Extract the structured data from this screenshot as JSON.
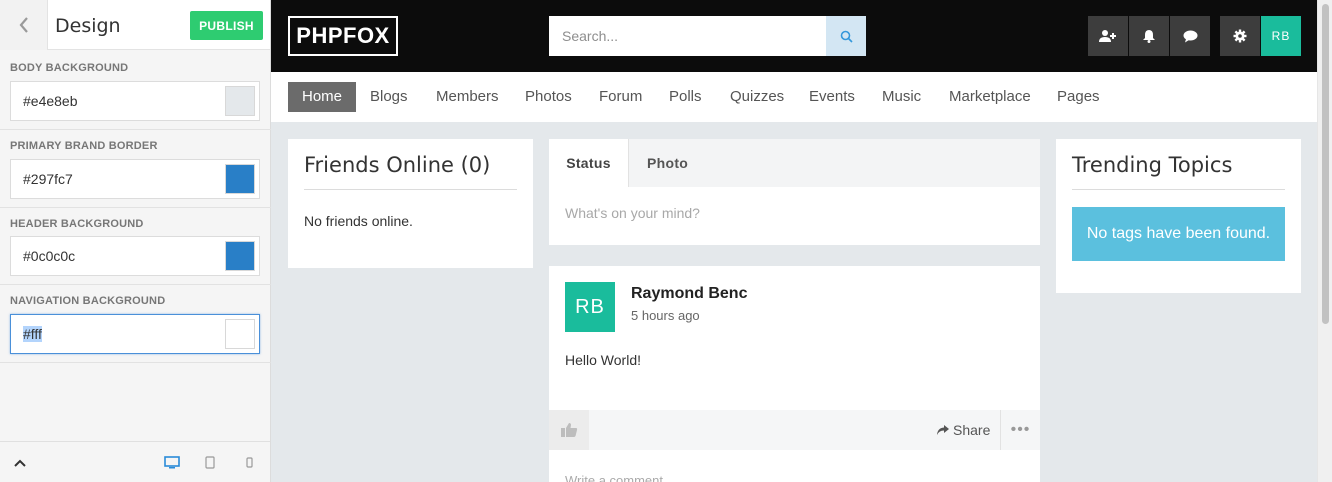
{
  "customizer": {
    "title": "Design",
    "publish_label": "PUBLISH",
    "fields": [
      {
        "label": "BODY BACKGROUND",
        "value": "#e4e8eb",
        "swatch": "#e4e8eb"
      },
      {
        "label": "PRIMARY BRAND BORDER",
        "value": "#297fc7",
        "swatch": "#297fc7"
      },
      {
        "label": "HEADER BACKGROUND",
        "value": "#0c0c0c",
        "swatch": "#297fc7"
      },
      {
        "label": "NAVIGATION BACKGROUND",
        "value": "#fff",
        "swatch": "#ffffff"
      }
    ],
    "footer_icons": [
      "collapse-up-icon",
      "desktop-preview-icon",
      "tablet-preview-icon",
      "mobile-preview-icon"
    ]
  },
  "header": {
    "logo": "PHPFOX",
    "search_placeholder": "Search...",
    "avatar_initials": "RB",
    "icons": [
      "add-friend-icon",
      "bell-icon",
      "chat-icon",
      "gear-icon"
    ]
  },
  "nav": {
    "items": [
      "Home",
      "Blogs",
      "Members",
      "Photos",
      "Forum",
      "Polls",
      "Quizzes",
      "Events",
      "Music",
      "Marketplace",
      "Pages"
    ],
    "active": "Home"
  },
  "friends": {
    "title": "Friends Online (0)",
    "empty": "No friends online."
  },
  "composer": {
    "tabs": [
      "Status",
      "Photo"
    ],
    "placeholder": "What's on your mind?"
  },
  "feed": {
    "avatar_initials": "RB",
    "author": "Raymond Benc",
    "time": "5 hours ago",
    "text": "Hello World!",
    "share_label": "Share",
    "more_label": "•••",
    "comment_placeholder": "Write a comment..."
  },
  "trending": {
    "title": "Trending Topics",
    "empty": "No tags have been found."
  },
  "colors": {
    "header": "#0c0c0c",
    "accent": "#1abc9c",
    "publish": "#2ecc71",
    "info": "#5bc0de"
  }
}
